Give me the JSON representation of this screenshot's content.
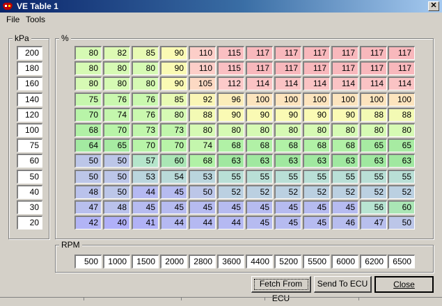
{
  "window": {
    "title": "VE Table 1",
    "close_glyph": "✕"
  },
  "menu": {
    "file": "File",
    "tools": "Tools"
  },
  "groups": {
    "kpa_label": "kPa",
    "pct_label": "%",
    "rpm_label": "RPM"
  },
  "kpa": [
    "200",
    "180",
    "160",
    "140",
    "120",
    "100",
    "75",
    "60",
    "50",
    "40",
    "30",
    "20"
  ],
  "rpm": [
    "500",
    "1000",
    "1500",
    "2000",
    "2800",
    "3600",
    "4400",
    "5200",
    "5500",
    "6000",
    "6200",
    "6500"
  ],
  "ve": [
    [
      "80",
      "82",
      "85",
      "90",
      "110",
      "115",
      "117",
      "117",
      "117",
      "117",
      "117",
      "117"
    ],
    [
      "80",
      "80",
      "80",
      "90",
      "110",
      "115",
      "117",
      "117",
      "117",
      "117",
      "117",
      "117"
    ],
    [
      "80",
      "80",
      "80",
      "90",
      "105",
      "112",
      "114",
      "114",
      "114",
      "114",
      "114",
      "114"
    ],
    [
      "75",
      "76",
      "76",
      "85",
      "92",
      "96",
      "100",
      "100",
      "100",
      "100",
      "100",
      "100"
    ],
    [
      "70",
      "74",
      "76",
      "80",
      "88",
      "90",
      "90",
      "90",
      "90",
      "90",
      "88",
      "88"
    ],
    [
      "68",
      "70",
      "73",
      "73",
      "80",
      "80",
      "80",
      "80",
      "80",
      "80",
      "80",
      "80"
    ],
    [
      "64",
      "65",
      "70",
      "70",
      "74",
      "68",
      "68",
      "68",
      "68",
      "68",
      "65",
      "65"
    ],
    [
      "50",
      "50",
      "57",
      "60",
      "68",
      "63",
      "63",
      "63",
      "63",
      "63",
      "63",
      "63"
    ],
    [
      "50",
      "50",
      "53",
      "54",
      "53",
      "55",
      "55",
      "55",
      "55",
      "55",
      "55",
      "55"
    ],
    [
      "48",
      "50",
      "44",
      "45",
      "50",
      "52",
      "52",
      "52",
      "52",
      "52",
      "52",
      "52"
    ],
    [
      "47",
      "48",
      "45",
      "45",
      "45",
      "45",
      "45",
      "45",
      "45",
      "45",
      "56",
      "60"
    ],
    [
      "42",
      "40",
      "41",
      "44",
      "44",
      "44",
      "45",
      "45",
      "45",
      "46",
      "47",
      "50"
    ]
  ],
  "buttons": {
    "fetch": "Fetch From ECU",
    "send": "Send To ECU",
    "close": "Close"
  }
}
